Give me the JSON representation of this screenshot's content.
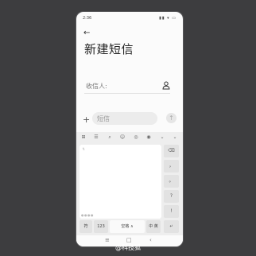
{
  "status_bar": {
    "time": "2:36",
    "icons": "▮▮ ▾ ▭"
  },
  "header": {
    "back_icon": "←",
    "title": "新建短信"
  },
  "recipient": {
    "label": "收信人:",
    "icon": "person-icon"
  },
  "compose": {
    "plus": "+",
    "placeholder": "短信",
    "send": "↑"
  },
  "keyboard": {
    "toolbar": [
      "⊞",
      "☰",
      "⌕",
      "☺",
      "◎",
      "◉",
      "⌄"
    ],
    "handwriting_hint": "↯",
    "handwriting_dots": "●●●●",
    "side_keys": [
      "⌫",
      "，",
      "。",
      "?",
      "!"
    ],
    "bottom_keys": {
      "sym": "符",
      "num": "123",
      "space": "空格 ∧",
      "switch": "中\n英",
      "enter": "↵"
    }
  },
  "navbar": {
    "menu": "≡",
    "home": "□",
    "back": "‹"
  },
  "watermark": "@科技狐"
}
